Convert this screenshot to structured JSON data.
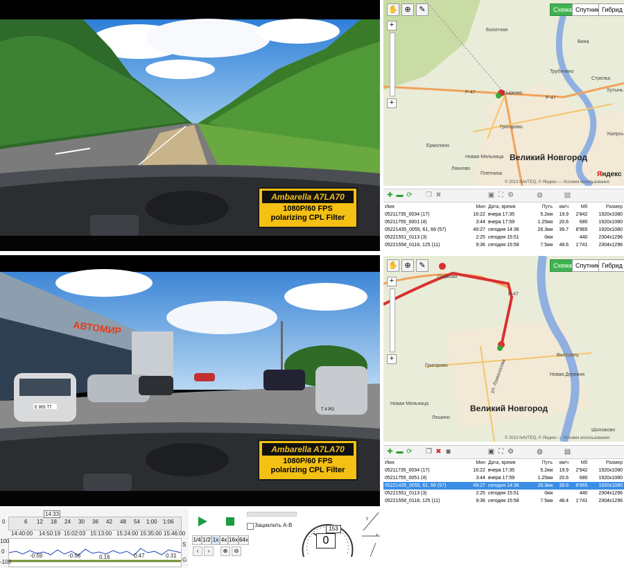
{
  "badges": [
    {
      "brand": "Ambarella A7LA70",
      "line2": "1080P/60 FPS",
      "line3": "polarizing CPL Filter"
    },
    {
      "brand": "Ambarella A7LA70",
      "line2": "1080P/60 FPS",
      "line3": "polarizing CPL Filter"
    }
  ],
  "scene2": {
    "store_sign": "АВТОМИР",
    "plate1": "Е 955 ТТ",
    "plate2": "Т 4 РО"
  },
  "map_buttons": {
    "scheme": "Схема",
    "satellite": "Спутник",
    "hybrid": "Гибрид"
  },
  "map1": {
    "labels": {
      "bolotnaya": "Болотная",
      "vinka": "Вина",
      "trubichino": "Трубичино",
      "strelka": "Стрелка",
      "khutyn": "Хутынь",
      "sirkovo": "Сырково",
      "grigorovo": "Григорово",
      "ermolino": "Ермолино",
      "novaya_melnitsa": "Новая Мельница",
      "lyakhnovo": "Ляхново",
      "pletnikha": "Плетниха",
      "uzhma": "Ушерсь",
      "road": "Р-47",
      "road2": "Р-47",
      "city": "Великий Новгород"
    },
    "copyright": "© 2013 NAVTEQ, © Яндекс — Условия использования",
    "logo": "Яндекс"
  },
  "map2": {
    "labels": {
      "sirkovo": "Сырково",
      "grigorovo": "Григорово",
      "novaya_melnitsa": "Новая Мельница",
      "leshino": "Лешино",
      "volkhovets": "Волховец",
      "novaya_derevnya": "Новая Деревня",
      "city": "Великий Новгород",
      "sholokhovo": "Шоложово",
      "road": "Р-47",
      "street": "ул. Ломоносова"
    },
    "copyright": "© 2013 NAVTEQ, © Яндекс — Условия использования",
    "logo": "Яндекс"
  },
  "table_headers": {
    "name": "Имя",
    "min": "Мин",
    "date": "Дата, время",
    "path": "Путь",
    "kmh": "км/ч",
    "mb": "Мб",
    "size": "Размер"
  },
  "table1": [
    {
      "name": "05211735_0034 (17)",
      "min": "16:22",
      "date": "вчера 17:35",
      "path": "5.2км",
      "kmh": "19.9",
      "mb": "2'842",
      "size": "1920x1080"
    },
    {
      "name": "05211755_0001 (4)",
      "min": "3:44",
      "date": "вчера 17:59",
      "path": "1.25км",
      "kmh": "20.6",
      "mb": "680",
      "size": "1920x1080"
    },
    {
      "name": "05221435_0055, 61, 66 (57)",
      "min": "49:27",
      "date": "сегодня 14:36",
      "path": "26.3км",
      "kmh": "39.7",
      "mb": "8'965",
      "size": "1920x1080"
    },
    {
      "name": "05221551_0113 (3)",
      "min": "2:25",
      "date": "сегодня 15:51",
      "path": "0км",
      "kmh": "",
      "mb": "440",
      "size": "2304x1296"
    },
    {
      "name": "05221558_0118, 125 (11)",
      "min": "9:36",
      "date": "сегодня 15:58",
      "path": "7.5км",
      "kmh": "48.6",
      "mb": "1'741",
      "size": "2304x1296"
    }
  ],
  "table2": [
    {
      "name": "05211735_0034 (17)",
      "min": "16:22",
      "date": "вчера 17:35",
      "path": "5.2км",
      "kmh": "19.9",
      "mb": "2'942",
      "size": "1920x1080"
    },
    {
      "name": "05211755_0051 (4)",
      "min": "3:44",
      "date": "вчера 17:59",
      "path": "1.25км",
      "kmh": "20.6",
      "mb": "680",
      "size": "1920x1080"
    },
    {
      "name": "05221435_0055, 61, 66 (57)",
      "min": "49:27",
      "date": "сегодня 14:36",
      "path": "26.3км",
      "kmh": "39.6",
      "mb": "8'965",
      "size": "1920x1080"
    },
    {
      "name": "05221551_0113 (3)",
      "min": "2:25",
      "date": "сегодня 15:51",
      "path": "0км",
      "kmh": "",
      "mb": "440",
      "size": "2304x1296"
    },
    {
      "name": "05221558_0118, 125 (11)",
      "min": "9:36",
      "date": "сегодня 15:58",
      "path": "7.5км",
      "kmh": "48.4",
      "mb": "1'741",
      "size": "2304x1296"
    }
  ],
  "timeline": {
    "ticks": [
      "0",
      "6",
      "12",
      "18",
      "24",
      "30",
      "36",
      "42",
      "48",
      "54",
      "1:00",
      "1:06"
    ],
    "marker": "14:33",
    "times": [
      "14:40:00",
      "14:50:19",
      "15:02:03",
      "15:13:00",
      "15:24:00",
      "15:35:00",
      "15:46:00"
    ],
    "y_top": "100",
    "y_mid": "0",
    "y_bot": "-100",
    "readings": [
      "-0.59",
      "-0.56",
      "0.16",
      "0.47",
      "0.31"
    ],
    "axis_s": "S",
    "axis_g": "G"
  },
  "playback": {
    "speeds": [
      "1/4",
      "1/2",
      "1x",
      "4x",
      "16x",
      "64x"
    ],
    "lock_label": "Зациклить A-B"
  },
  "speedometer": {
    "speed": "0",
    "odo": "153"
  }
}
